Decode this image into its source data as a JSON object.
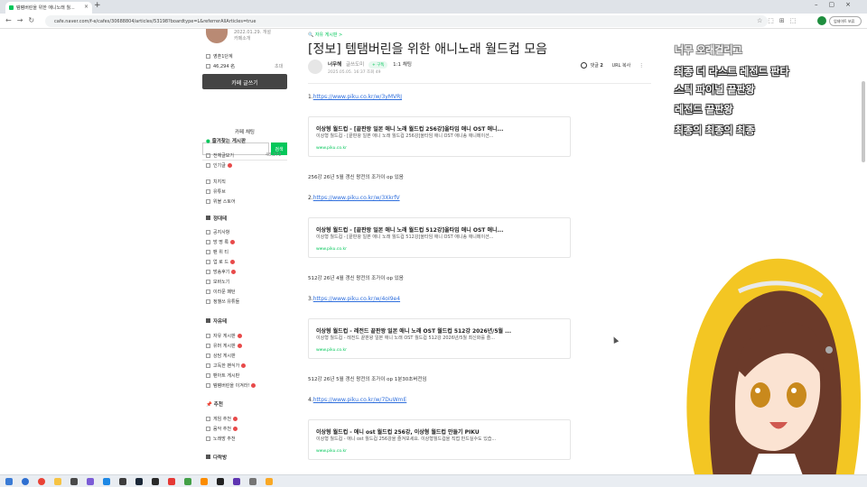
{
  "browser": {
    "tab_title": "템템버린을 위한 애니노래 월...",
    "address": "cafe.naver.com/f-e/cafes/30688804/articles/53198?boardtype=L&referrerAllArticles=true",
    "profile_label": "업데이트 보류"
  },
  "sidebar": {
    "join_date": "2022.01.29. 개설",
    "cafe_intro": "카페소개",
    "grade": "영혼1단계",
    "members": "46,294 名",
    "invite": "초대",
    "write_label": "카페 글쓰기",
    "chat_label": "카페 채팅",
    "search_btn": "검색",
    "fav_boards": "즐겨찾는 게시판",
    "all_posts": "전체글보기",
    "all_posts_count": "48,272",
    "popular": "인기글",
    "items_a": [
      "치지직",
      "유튜브",
      "위블 스토어"
    ],
    "notice_section": "정대테",
    "items_b": [
      "공지사항",
      "방 명 록",
      "팬 위 티",
      "업 로 드",
      "방송후기",
      "모바노기",
      "이라문 패턴",
      "정챌쓰 유튜들"
    ],
    "free_section": "자유테",
    "items_c": [
      "자유 게시판",
      "유머 게시판",
      "상담 게시판",
      "고독한 팬식가",
      "팬아트 게시판",
      "템템버린을 이겨라!"
    ],
    "recommend_section": "추천",
    "items_d": [
      "게임 추천",
      "음악 추천",
      "노래방 추천"
    ],
    "etc_section": "다락방"
  },
  "article": {
    "breadcrumb": "자유 게시판 >",
    "title": "[정보] 템탬버린을 위한 애니노래 월드컵 모음",
    "author": "너무해",
    "author_grade": "글쓰도미",
    "badge": "+ 구독",
    "chat_label": "1:1 채팅",
    "date": "2025.05.05. 16:37  조회 49",
    "comment_label": "댓글",
    "comment_count": "2",
    "url_copy": "URL 복사",
    "more": "⋮",
    "links": [
      {
        "num": "1.",
        "url": "https://www.piku.co.kr/w/3yMVRJ"
      },
      {
        "num": "2.",
        "url": "https://www.piku.co.kr/w/3XkrfV"
      },
      {
        "num": "3.",
        "url": "https://www.piku.co.kr/w/4oI9e4"
      },
      {
        "num": "4.",
        "url": "https://www.piku.co.kr/w/7DuWmE"
      }
    ],
    "cards": [
      {
        "title": "이상형 월드컵 - [끝판왕 일본 애니 노래 월드컵 256강]올타임 애니 OST 애니...",
        "desc": "이상형 월드컵 - [끝판왕 일본 애니 노래 월드컵 256강]올타임 애니 OST 애니송 애니메이션...",
        "url": "www.piku.co.kr"
      },
      {
        "title": "이상형 월드컵 - [끝판왕 일본 애니 노래 월드컵 512강]올타임 애니 OST 애니...",
        "desc": "이상형 월드컵 - [끝판왕 일본 애니 노래 월드컵 512강]올타임 애니 OST 애니송 애니메이션...",
        "url": "www.piku.co.kr"
      },
      {
        "title": "이상형 월드컵 - 레전드 끝판왕 일본 애니 노래 OST 월드컵 512강 2026년/5월 ...",
        "desc": "이상형 월드컵 - 레전드 끝판왕 일본 애니 노래 OST 월드컵 512강 2026년/5월 최신화를 졸...",
        "url": "www.piku.co.kr"
      },
      {
        "title": "이상형 월드컵 - 애니 ost 월드컵 256강, 이상형 월드컵 만들기 PIKU",
        "desc": "이상형 월드컵 - 애니 ost 월드컵 256강을 즐겨보세요. 이상형월드컵을 직접 만드실수도 있습...",
        "url": "www.piku.co.kr"
      }
    ],
    "notes": [
      "256강 26년 5월 갱신 왕전의 조가이 op 있음",
      "512강 26년 4월 갱신 왕전의 조가이 op 있음",
      "512강 26년 5월 갱신 왕전의 조가이 op 1분30초버전임"
    ]
  },
  "overlay": {
    "lines": [
      "너무 오래걸리고",
      "최종 더 라스트 레전드 판타",
      "스틱 파이널 끝판왕",
      "레전드 끝판왕",
      "최종의 최종의 최종"
    ]
  },
  "colors": {
    "naver_green": "#03c75a",
    "link_blue": "#2f6fdd",
    "write_button": "#444444"
  }
}
